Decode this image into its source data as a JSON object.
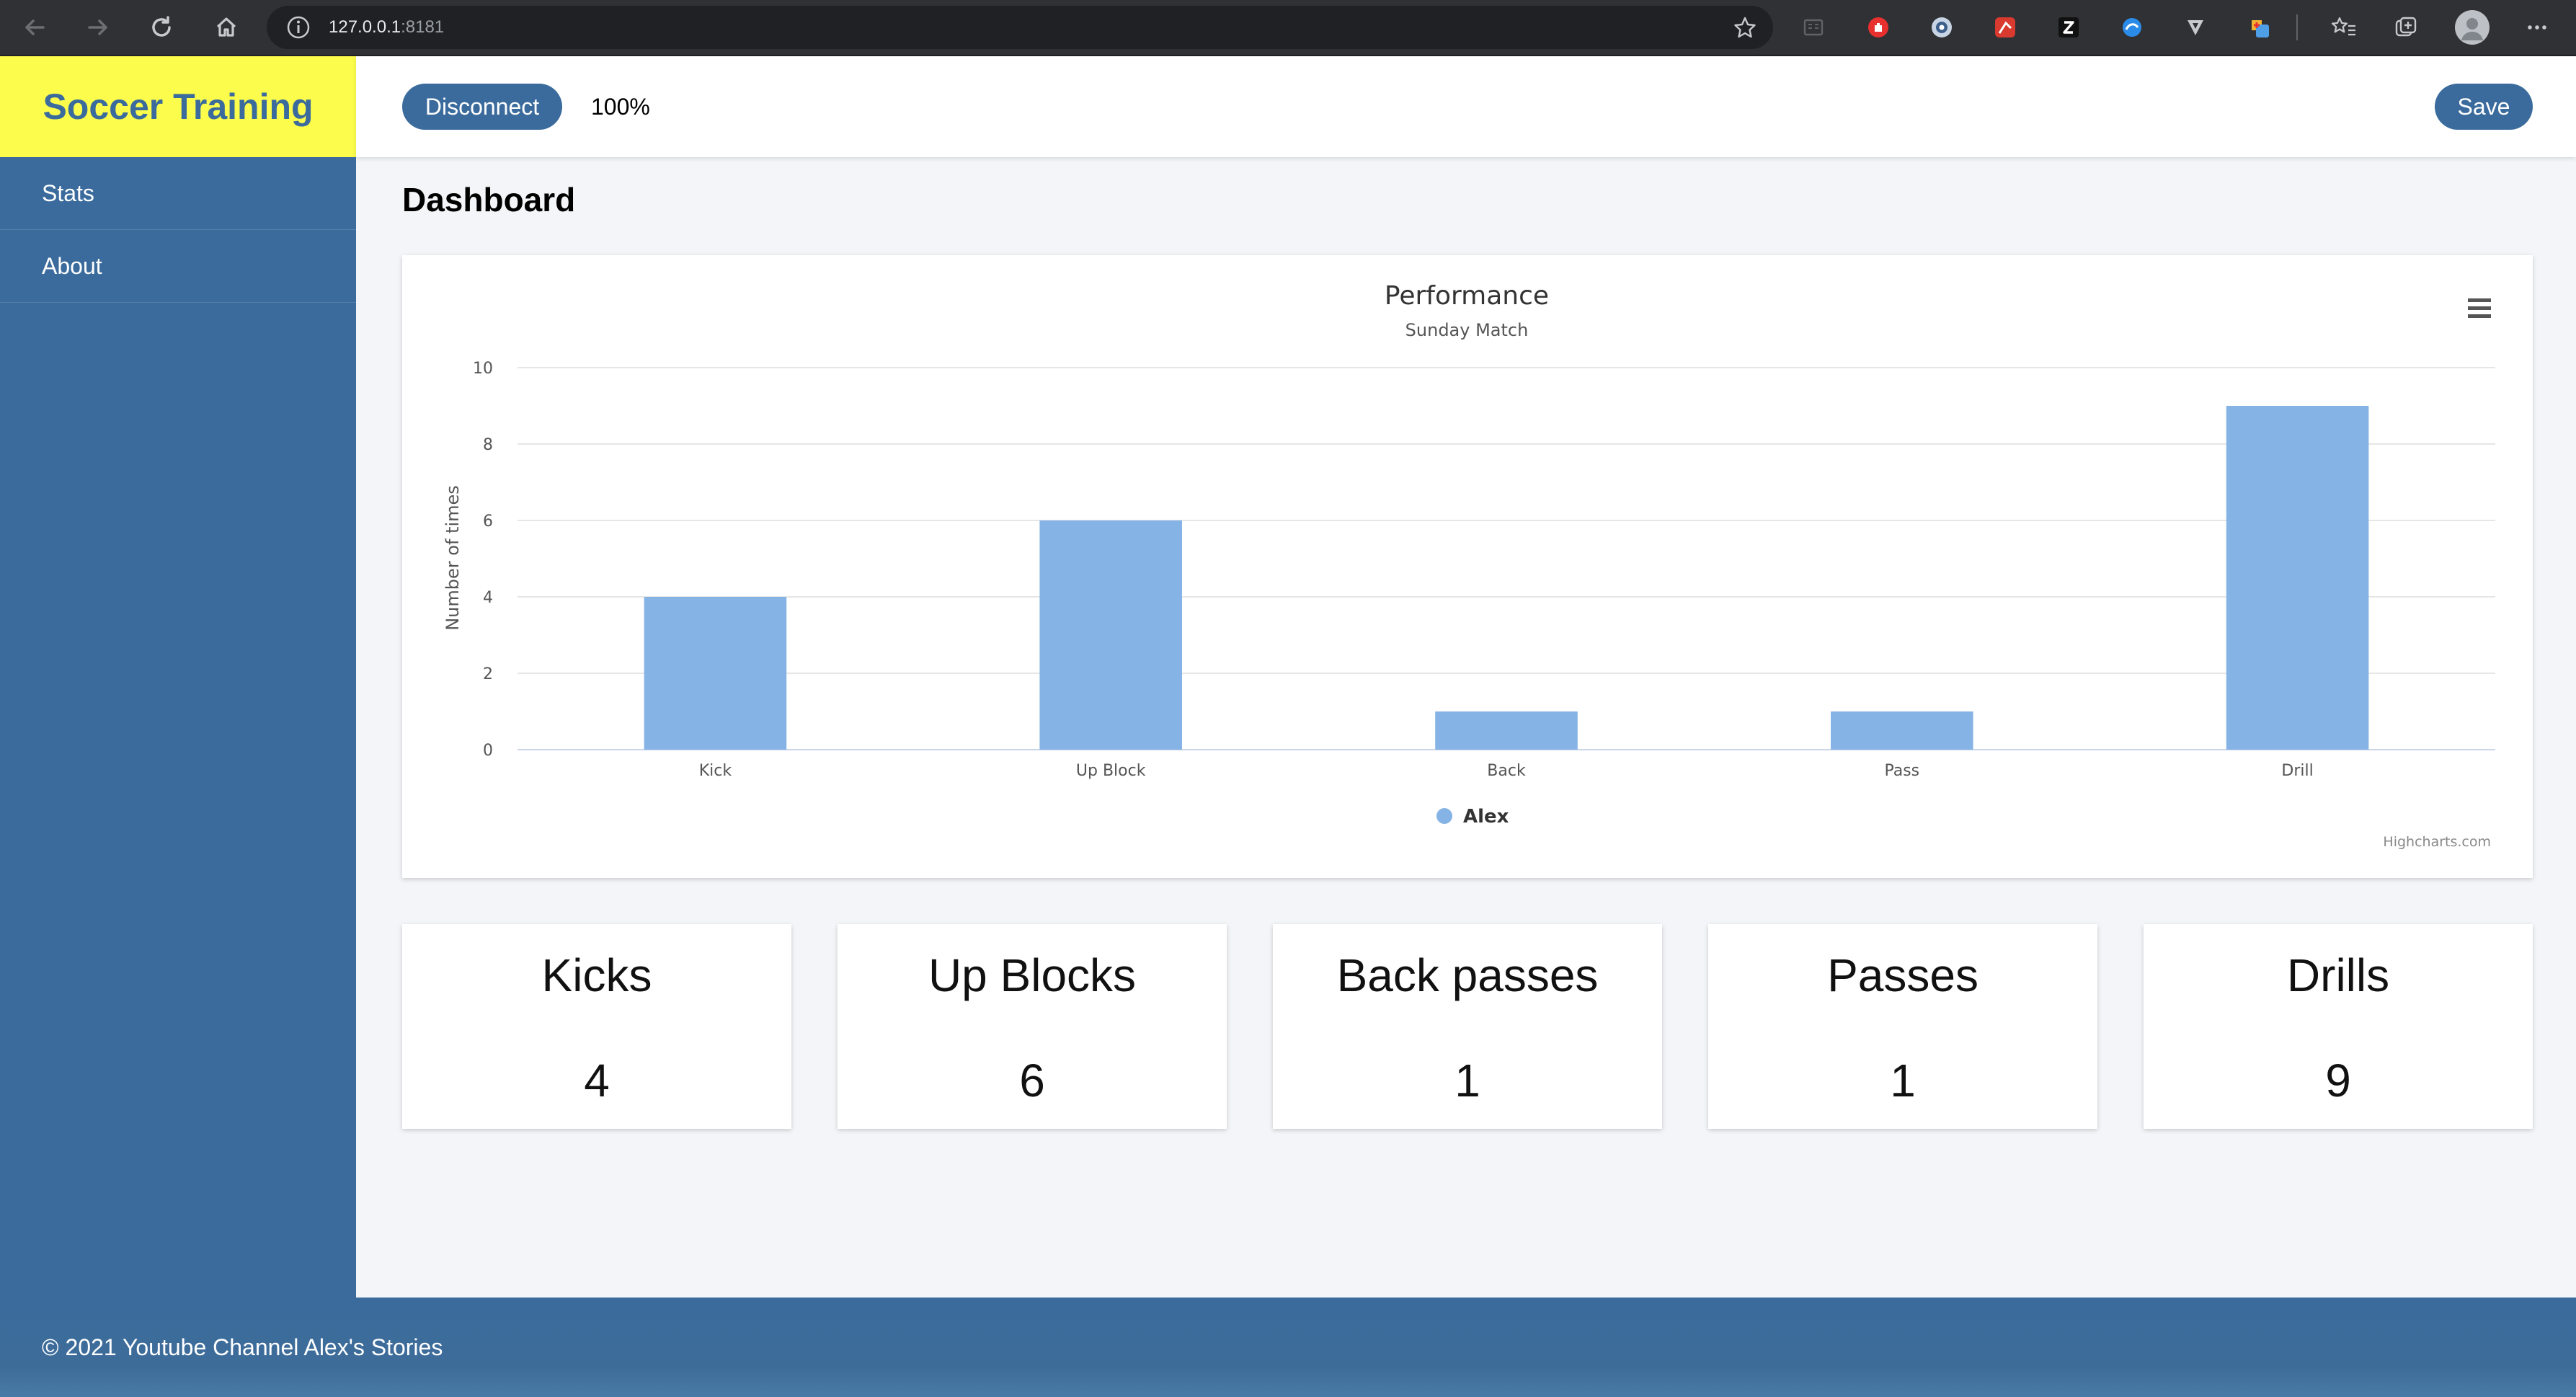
{
  "browser": {
    "url_host": "127.0.0.1",
    "url_port": ":8181"
  },
  "app": {
    "brand": "Soccer Training",
    "disconnect_label": "Disconnect",
    "progress_text": "100%",
    "save_label": "Save"
  },
  "sidebar": {
    "items": [
      {
        "label": "Stats"
      },
      {
        "label": "About"
      }
    ]
  },
  "page_title": "Dashboard",
  "chart_data": {
    "type": "bar",
    "title": "Performance",
    "subtitle": "Sunday Match",
    "xlabel": "",
    "ylabel": "Number of times",
    "categories": [
      "Kick",
      "Up Block",
      "Back",
      "Pass",
      "Drill"
    ],
    "series": [
      {
        "name": "Alex",
        "values": [
          4,
          6,
          1,
          1,
          9
        ],
        "color": "#86b3e6"
      }
    ],
    "ylim": [
      0,
      10
    ],
    "yticks": [
      0,
      2,
      4,
      6,
      8,
      10
    ],
    "grid": true,
    "legend_position": "bottom-center",
    "credits": "Highcharts.com"
  },
  "stats": [
    {
      "label": "Kicks",
      "value": "4"
    },
    {
      "label": "Up Blocks",
      "value": "6"
    },
    {
      "label": "Back passes",
      "value": "1"
    },
    {
      "label": "Passes",
      "value": "1"
    },
    {
      "label": "Drills",
      "value": "9"
    }
  ],
  "footer_text": "© 2021 Youtube Channel Alex's Stories",
  "colors": {
    "brand_bg": "#fcfc4c",
    "primary": "#3a6b9c",
    "bar": "#86b3e6"
  }
}
